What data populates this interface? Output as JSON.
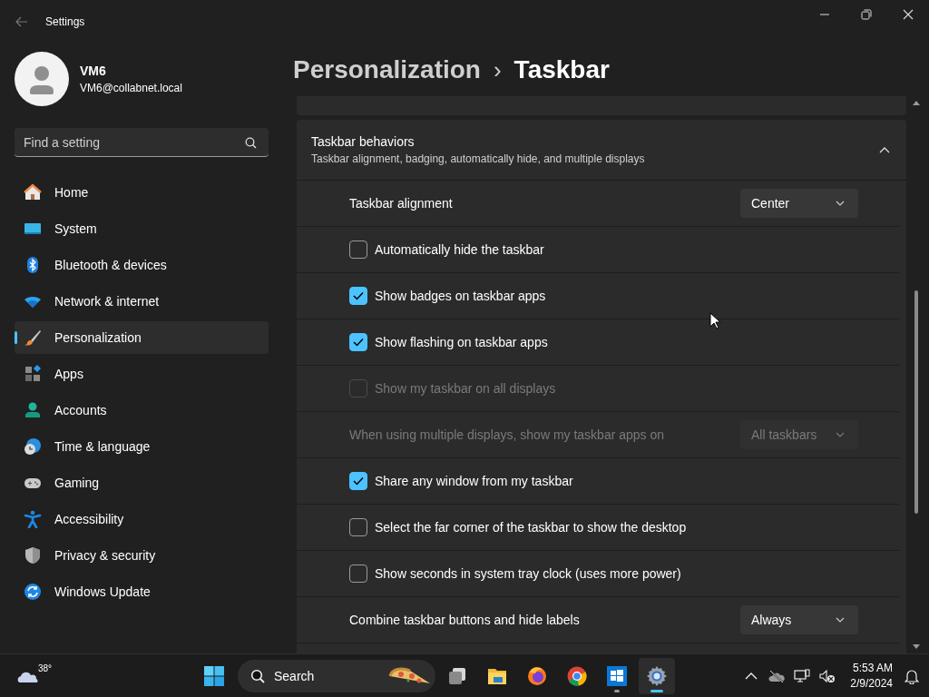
{
  "window": {
    "title": "Settings"
  },
  "profile": {
    "name": "VM6",
    "email": "VM6@collabnet.local"
  },
  "search": {
    "placeholder": "Find a setting"
  },
  "sidebar": {
    "items": [
      {
        "label": "Home",
        "selected": false
      },
      {
        "label": "System",
        "selected": false
      },
      {
        "label": "Bluetooth & devices",
        "selected": false
      },
      {
        "label": "Network & internet",
        "selected": false
      },
      {
        "label": "Personalization",
        "selected": true
      },
      {
        "label": "Apps",
        "selected": false
      },
      {
        "label": "Accounts",
        "selected": false
      },
      {
        "label": "Time & language",
        "selected": false
      },
      {
        "label": "Gaming",
        "selected": false
      },
      {
        "label": "Accessibility",
        "selected": false
      },
      {
        "label": "Privacy & security",
        "selected": false
      },
      {
        "label": "Windows Update",
        "selected": false
      }
    ]
  },
  "breadcrumb": {
    "parent": "Personalization",
    "separator": "›",
    "current": "Taskbar"
  },
  "section": {
    "title": "Taskbar behaviors",
    "subtitle": "Taskbar alignment, badging, automatically hide, and multiple displays",
    "expanded": true
  },
  "settings": [
    {
      "kind": "dropdown",
      "label": "Taskbar alignment",
      "value": "Center",
      "disabled": false
    },
    {
      "kind": "checkbox",
      "label": "Automatically hide the taskbar",
      "checked": false,
      "disabled": false
    },
    {
      "kind": "checkbox",
      "label": "Show badges on taskbar apps",
      "checked": true,
      "disabled": false
    },
    {
      "kind": "checkbox",
      "label": "Show flashing on taskbar apps",
      "checked": true,
      "disabled": false
    },
    {
      "kind": "checkbox",
      "label": "Show my taskbar on all displays",
      "checked": false,
      "disabled": true
    },
    {
      "kind": "dropdown",
      "label": "When using multiple displays, show my taskbar apps on",
      "value": "All taskbars",
      "disabled": true
    },
    {
      "kind": "checkbox",
      "label": "Share any window from my taskbar",
      "checked": true,
      "disabled": false
    },
    {
      "kind": "checkbox",
      "label": "Select the far corner of the taskbar to show the desktop",
      "checked": false,
      "disabled": false
    },
    {
      "kind": "checkbox",
      "label": "Show seconds in system tray clock (uses more power)",
      "checked": false,
      "disabled": false
    },
    {
      "kind": "dropdown",
      "label": "Combine taskbar buttons and hide labels",
      "value": "Always",
      "disabled": false
    }
  ],
  "taskbar": {
    "weather": "38°",
    "search": "Search",
    "apps": [
      {
        "selected": false,
        "running": false
      },
      {
        "selected": false,
        "running": false
      },
      {
        "selected": false,
        "running": false
      },
      {
        "selected": false,
        "running": false
      },
      {
        "selected": false,
        "running": true
      },
      {
        "selected": true,
        "running": true
      }
    ],
    "time": "5:53 AM",
    "date": "2/9/2024"
  }
}
